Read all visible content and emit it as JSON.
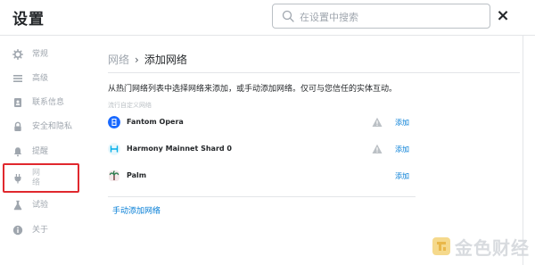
{
  "header": {
    "title": "设置",
    "search_placeholder": "在设置中搜索",
    "close_label": "×"
  },
  "sidebar": {
    "items": [
      {
        "label": "常规",
        "icon": "gear-icon"
      },
      {
        "label": "高级",
        "icon": "menu-lines-icon"
      },
      {
        "label": "联系信息",
        "icon": "address-book-icon"
      },
      {
        "label": "安全和隐私",
        "icon": "lock-icon"
      },
      {
        "label": "提醒",
        "icon": "bell-icon"
      },
      {
        "label": "网\n络",
        "icon": "plug-icon"
      },
      {
        "label": "试验",
        "icon": "flask-icon"
      },
      {
        "label": "关于",
        "icon": "info-icon"
      }
    ],
    "active_index": 5,
    "highlight_color": "#e0282e"
  },
  "main": {
    "breadcrumb_root": "网络",
    "breadcrumb_sep": "›",
    "breadcrumb_current": "添加网络",
    "description": "从热门网络列表中选择网络来添加，或手动添加网络。仅可与您信任的实体互动。",
    "subheading": "流行自定义网络",
    "networks": [
      {
        "name": "Fantom Opera",
        "has_warning": true,
        "add_label": "添加",
        "logo_color": "#1969ff"
      },
      {
        "name": "Harmony Mainnet Shard 0",
        "has_warning": true,
        "add_label": "添加",
        "logo_color": "#00aee9"
      },
      {
        "name": "Palm",
        "has_warning": false,
        "add_label": "添加",
        "logo_color": "#6e3b3b"
      }
    ],
    "manual_add_label": "手动添加网络"
  },
  "watermark": {
    "text": "金色财经"
  },
  "colors": {
    "link": "#037dd6",
    "muted": "#9fa6ae",
    "text": "#24272a",
    "warning": "#bbc0c5"
  }
}
